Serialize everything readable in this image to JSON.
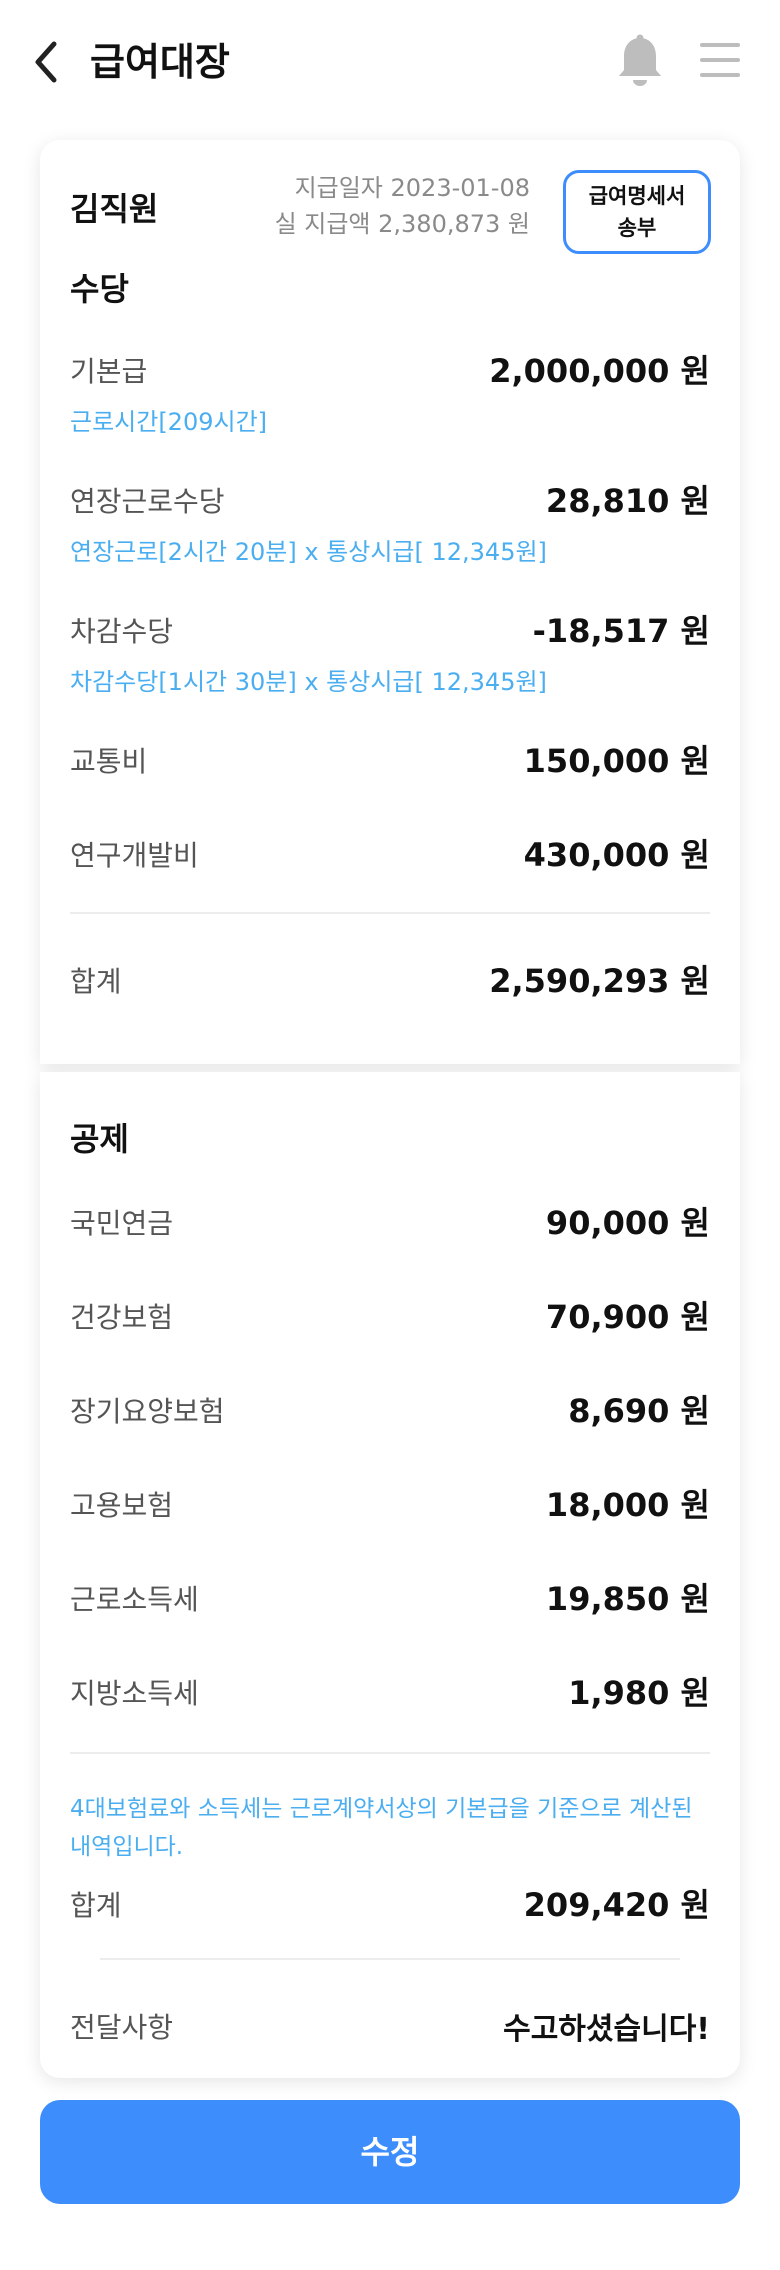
{
  "header": {
    "title": "급여대장",
    "back_icon": "chevron-left-icon",
    "bell_icon": "bell-icon",
    "menu_icon": "hamburger-menu-icon"
  },
  "employee": {
    "name": "김직원",
    "pay_date": "지급일자 2023-01-08",
    "net_pay": "실 지급액 2,380,873 원"
  },
  "send_button": {
    "line1": "급여명세서",
    "line2": "송부"
  },
  "allowances": {
    "title": "수당",
    "items": [
      {
        "label": "기본급",
        "amount": "2,000,000 원",
        "detail": "근로시간[209시간]"
      },
      {
        "label": "연장근로수당",
        "amount": "28,810 원",
        "detail": "연장근로[2시간 20분] x 통상시급[ 12,345원]"
      },
      {
        "label": "차감수당",
        "amount": "-18,517 원",
        "detail": "차감수당[1시간 30분] x 통상시급[ 12,345원]"
      },
      {
        "label": "교통비",
        "amount": "150,000 원"
      },
      {
        "label": "연구개발비",
        "amount": "430,000 원"
      }
    ],
    "total_label": "합계",
    "total_amount": "2,590,293 원"
  },
  "deductions": {
    "title": "공제",
    "items": [
      {
        "label": "국민연금",
        "amount": "90,000 원"
      },
      {
        "label": "건강보험",
        "amount": "70,900 원"
      },
      {
        "label": "장기요양보험",
        "amount": "8,690 원"
      },
      {
        "label": "고용보험",
        "amount": "18,000 원"
      },
      {
        "label": "근로소득세",
        "amount": "19,850 원"
      },
      {
        "label": "지방소득세",
        "amount": "1,980 원"
      }
    ],
    "notice": "4대보험료와 소득세는 근로계약서상의 기본급을 기준으로 계산된 내역입니다.",
    "total_label": "합계",
    "total_amount": "209,420 원",
    "message_label": "전달사항",
    "message": "수고하셨습니다!"
  },
  "submit_button": {
    "label": "수정"
  },
  "colors": {
    "accent": "#3d8dfc",
    "detail_text": "#4aaef0",
    "muted_text": "#8a8a8a"
  }
}
